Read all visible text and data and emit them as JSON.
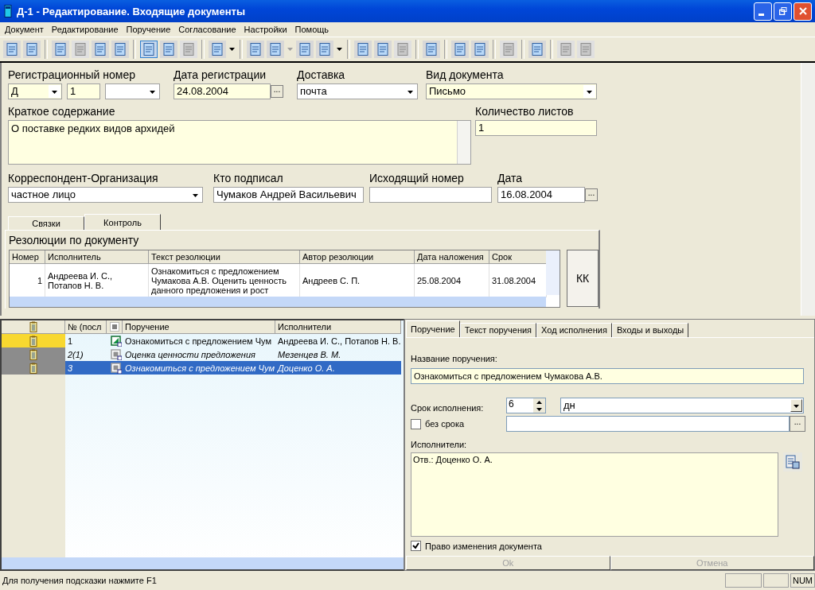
{
  "window": {
    "title": "Д-1 - Редактирование. Входящие документы"
  },
  "menu": [
    {
      "label": "Документ"
    },
    {
      "label": "Редактирование"
    },
    {
      "label": "Поручение"
    },
    {
      "label": "Согласование"
    },
    {
      "label": "Настройки"
    },
    {
      "label": "Помощь"
    }
  ],
  "toolbar": [
    [
      {
        "kind": "button",
        "disabled": false,
        "pressed": false
      },
      {
        "kind": "button",
        "disabled": false,
        "pressed": false
      }
    ],
    [
      {
        "kind": "button",
        "disabled": false,
        "pressed": false
      },
      {
        "kind": "button",
        "disabled": true,
        "pressed": false
      },
      {
        "kind": "button",
        "disabled": false,
        "pressed": false
      },
      {
        "kind": "button",
        "disabled": false,
        "pressed": false
      }
    ],
    [
      {
        "kind": "button",
        "disabled": false,
        "pressed": true
      },
      {
        "kind": "button",
        "disabled": false,
        "pressed": false
      },
      {
        "kind": "button",
        "disabled": true,
        "pressed": false
      }
    ],
    [
      {
        "kind": "button",
        "disabled": false,
        "pressed": false
      },
      {
        "kind": "dropdown",
        "disabled": false
      }
    ],
    [
      {
        "kind": "button",
        "disabled": false,
        "pressed": false
      },
      {
        "kind": "button",
        "disabled": false,
        "pressed": false
      },
      {
        "kind": "dropdown",
        "disabled": true
      },
      {
        "kind": "button",
        "disabled": false,
        "pressed": false
      },
      {
        "kind": "button",
        "disabled": false,
        "pressed": false
      },
      {
        "kind": "dropdown",
        "disabled": false
      }
    ],
    [
      {
        "kind": "button",
        "disabled": false,
        "pressed": false
      },
      {
        "kind": "button",
        "disabled": false,
        "pressed": false
      },
      {
        "kind": "button",
        "disabled": true,
        "pressed": false
      }
    ],
    [
      {
        "kind": "button",
        "disabled": false,
        "pressed": false
      }
    ],
    [
      {
        "kind": "button",
        "disabled": false,
        "pressed": false
      },
      {
        "kind": "button",
        "disabled": false,
        "pressed": false
      }
    ],
    [
      {
        "kind": "button",
        "disabled": true,
        "pressed": false
      }
    ],
    [
      {
        "kind": "button",
        "disabled": false,
        "pressed": false
      }
    ],
    [
      {
        "kind": "button",
        "disabled": true,
        "pressed": false
      },
      {
        "kind": "button",
        "disabled": true,
        "pressed": false
      }
    ]
  ],
  "document": {
    "reg_number": {
      "label": "Регистрационный номер",
      "prefix": "Д",
      "number": "1"
    },
    "reg_date": {
      "label": "Дата регистрации",
      "value": "24.08.2004",
      "button": "..."
    },
    "delivery": {
      "label": "Доставка",
      "value": "почта"
    },
    "doc_type": {
      "label": "Вид документа",
      "value": "Письмо"
    },
    "summary": {
      "label": "Краткое содержание",
      "value": "О поставке редких видов архидей"
    },
    "sheets": {
      "label": "Количество листов",
      "value": "1"
    },
    "correspondent": {
      "label": "Корреспондент-Организация",
      "value": "частное лицо"
    },
    "signed_by": {
      "label": "Кто подписал",
      "value": "Чумаков Андрей Васильевич"
    },
    "outgoing_number": {
      "label": "Исходящий номер"
    },
    "date": {
      "label": "Дата",
      "value": "16.08.2004",
      "button": "..."
    }
  },
  "tabs": [
    {
      "label": "Связки",
      "selected": false
    },
    {
      "label": "Контроль",
      "selected": true
    }
  ],
  "resolutions": {
    "title": "Резолюции по документу",
    "columns": [
      "Номер",
      "Исполнитель",
      "Текст резолюции",
      "Автор резолюции",
      "Дата наложения",
      "Срок"
    ],
    "rows": [
      [
        "1",
        "Андреева И. С., Потапов Н. В.",
        "Ознакомиться с предложением Чумакова А.В. Оценить ценность данного предложения и рост",
        "Андреев С. П.",
        "25.08.2004",
        "31.08.2004"
      ]
    ],
    "button": "КК"
  },
  "tasks": {
    "columns": [
      "№ (посл",
      "Поручение",
      "Исполнители"
    ],
    "rows": [
      {
        "num": "1",
        "task": "Ознакомиться с предложением Чум",
        "executors": "Андреева И. С., Потапов Н. В.",
        "color": "#f8d830",
        "kind": "done",
        "italic": false,
        "selected": false
      },
      {
        "num": "2(1)",
        "task": "Оценка ценности предложения",
        "executors": "Мезенцев В. М.",
        "color": "#8c8c8c",
        "kind": "pending",
        "italic": true,
        "selected": false
      },
      {
        "num": "3",
        "task": "Ознакомиться с предложением Чум",
        "executors": "Доценко О. А.",
        "color": "#8c8c8c",
        "kind": "pending",
        "italic": true,
        "selected": true
      }
    ]
  },
  "task_tabs": [
    {
      "label": "Поручение",
      "selected": true
    },
    {
      "label": "Текст поручения",
      "selected": false
    },
    {
      "label": "Ход исполнения",
      "selected": false
    },
    {
      "label": "Входы и выходы",
      "selected": false
    }
  ],
  "task_form": {
    "name": {
      "label": "Название поручения:",
      "value": "Ознакомиться с предложением Чумакова А.В."
    },
    "term": {
      "label": "Срок исполнения:",
      "value": "6",
      "unit": "дн"
    },
    "no_term": {
      "label": "без срока",
      "checked": false,
      "button": "..."
    },
    "executors": {
      "label": "Исполнители:",
      "value": "Отв.: Доценко О. А."
    },
    "may_edit": {
      "label": "Право изменения документа",
      "checked": true
    },
    "buttons": [
      {
        "label": "Ok",
        "disabled": true
      },
      {
        "label": "Отмена",
        "disabled": true
      }
    ]
  },
  "status_bar": {
    "hint": "Для получения подсказки нажмите F1",
    "num": "NUM"
  }
}
